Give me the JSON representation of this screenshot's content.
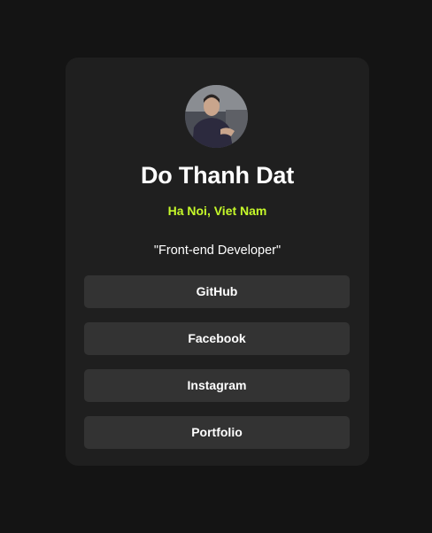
{
  "colors": {
    "background": "#141414",
    "card": "#1f1f1f",
    "button": "#333333",
    "accent": "#c5f82a",
    "text": "#ffffff"
  },
  "profile": {
    "avatar_icon": "profile-photo",
    "name": "Do Thanh Dat",
    "location": "Ha Noi, Viet Nam",
    "bio": "\"Front-end Developer\""
  },
  "links": [
    {
      "label": "GitHub"
    },
    {
      "label": "Facebook"
    },
    {
      "label": "Instagram"
    },
    {
      "label": "Portfolio"
    }
  ]
}
